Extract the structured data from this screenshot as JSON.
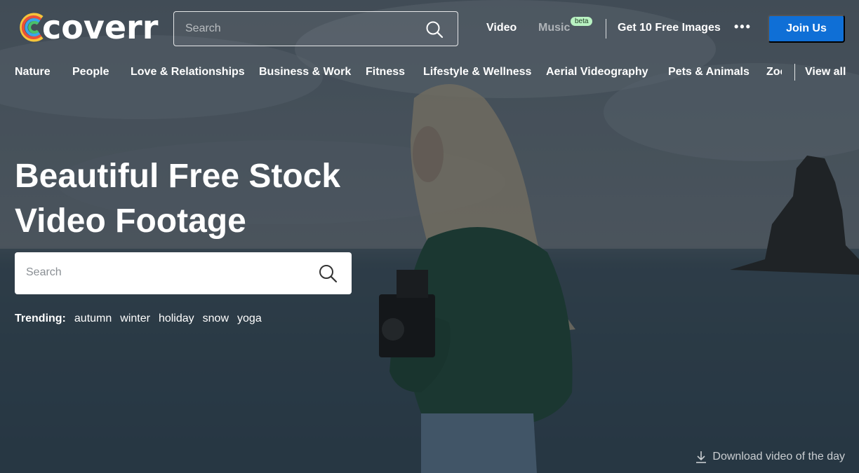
{
  "brand": {
    "name": "coverr"
  },
  "header": {
    "search_placeholder": "Search",
    "nav": {
      "video": "Video",
      "music": "Music",
      "beta": "beta",
      "images": "Get 10 Free Images",
      "more": "•••"
    },
    "join_label": "Join Us"
  },
  "categories": {
    "items": [
      "Nature",
      "People",
      "Love & Relationships",
      "Business & Work",
      "Fitness",
      "Lifestyle & Wellness",
      "Aerial Videography",
      "Pets & Animals",
      "Zoo"
    ],
    "view_all": "View all"
  },
  "hero": {
    "title_line1": "Beautiful Free Stock",
    "title_line2": "Video Footage",
    "search_placeholder": "Search",
    "trending_label": "Trending:",
    "trending": [
      "autumn",
      "winter",
      "holiday",
      "snow",
      "yoga"
    ],
    "download_label": "Download video of the day"
  },
  "icons": {
    "search": "search-icon",
    "download": "download-icon",
    "more": "more-dots-icon",
    "logo": "logo-icon"
  },
  "colors": {
    "accent": "#0f6fd6",
    "beta_badge": "#b9f2c2"
  }
}
